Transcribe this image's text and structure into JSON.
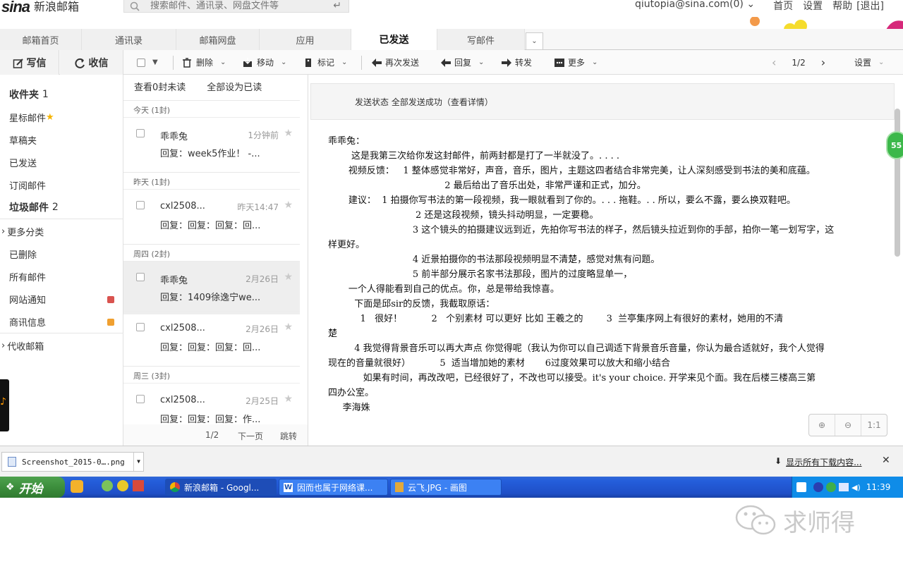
{
  "header": {
    "logo_mark": "sina",
    "logo_text": "新浪邮箱",
    "search_placeholder": "搜索邮件、通讯录、网盘文件等",
    "user": "qiutopia@sina.com(0)",
    "links": [
      "首页",
      "设置",
      "帮助",
      "[退出]"
    ]
  },
  "tabs": [
    "邮箱首页",
    "通讯录",
    "邮箱网盘",
    "应用",
    "已发送",
    "写邮件"
  ],
  "active_tab": "已发送",
  "toolbar": {
    "compose": "写信",
    "receive": "收信",
    "delete": "删除",
    "move": "移动",
    "mark": "标记",
    "resend": "再次发送",
    "reply": "回复",
    "forward": "转发",
    "more": "更多",
    "page": "1/2",
    "settings": "设置"
  },
  "sidebar": {
    "inbox": "收件夹",
    "inbox_count": "1",
    "starred": "星标邮件",
    "drafts": "草稿夹",
    "sent": "已发送",
    "subscriptions": "订阅邮件",
    "spam": "垃圾邮件",
    "spam_count": "2",
    "more_categories": "更多分类",
    "deleted": "已删除",
    "all_mail": "所有邮件",
    "site_notice": "网站通知",
    "commerce": "商讯信息",
    "collect": "代收邮箱",
    "site_notice_color": "#d9534f",
    "commerce_color": "#f0a030"
  },
  "list": {
    "view_unread": "查看0封未读",
    "mark_all_read": "全部设为已读",
    "groups": [
      "今天 (1封)",
      "昨天 (1封)",
      "周四 (2封)",
      "周三 (3封)"
    ],
    "messages": [
      {
        "from": "乖乖兔",
        "time": "1分钟前",
        "subject": "回复：week5作业！ -..."
      },
      {
        "from": "cxl2508...",
        "time": "昨天14:47",
        "subject": "回复：回复：回复：回..."
      },
      {
        "from": "乖乖兔",
        "time": "2月26日",
        "subject": "回复：1409徐逸宁we..."
      },
      {
        "from": "cxl2508...",
        "time": "2月26日",
        "subject": "回复：回复：回复：回..."
      },
      {
        "from": "cxl2508...",
        "time": "2月25日",
        "subject": "回复：回复：回复：作..."
      }
    ],
    "pager_page": "1/2",
    "pager_next": "下一页",
    "pager_jump": "跳转"
  },
  "reader": {
    "status": "发送状态 全部发送成功（查看详情）",
    "body_lines": [
      "乖乖兔：",
      "        这是我第三次给你发这封邮件，前两封都是打了一半就没了。. . . .",
      "       视频反馈：   1 整体感觉非常好，声音，音乐，图片，主题这四者结合非常完美，让人深刻感受到书法的美和底蕴。",
      "                                        2 最后给出了音乐出处，非常严谨和正式，加分。",
      "       建议：  1 拍摄你写书法的第一段视频，我一眼就看到了你的。. . . 拖鞋。. . 所以，要么不露，要么换双鞋吧。",
      "                              2 还是这段视频，镜头抖动明显，一定要稳。",
      "                             3 这个镜头的拍摄建议远到近，先拍你写书法的样子，然后镜头拉近到你的手部，拍你一笔一划写字，这",
      "样更好。",
      "                             4 近景拍摄你的书法那段视频明显不清楚，感觉对焦有问题。",
      "                             5 前半部分展示名家书法那段，图片的过度略显单一，",
      "       一个人得能看到自己的优点。你，总是带给我惊喜。",
      "         下面是邱sir的反馈，我截取原话：",
      "           1   很好！          2   个别素材 可以更好 比如 王羲之的        3  兰亭集序网上有很好的素材，她用的不清",
      "楚",
      "         4 我觉得背景音乐可以再大声点 你觉得呢（我认为你可以自己调适下背景音乐音量，你认为最合适就好，我个人觉得",
      "现在的音量就很好）          5  适当增加她的素材       6过度效果可以放大和缩小结合",
      "",
      "            如果有时间，再改改吧，已经很好了，不改也可以接受。it's your choice. 开学来见个面。我在后楼三楼高三第",
      "四办公室。",
      "",
      "     李海姝"
    ],
    "zoom_in": "⊕",
    "zoom_out": "⊖",
    "zoom_reset": "1:1",
    "badge": "55"
  },
  "download": {
    "file": "Screenshot_2015-0….png",
    "show_all": "显示所有下载内容..."
  },
  "taskbar": {
    "start": "开始",
    "tasks": [
      "新浪邮箱 - Googl...",
      "因而也属于网络课...",
      "云飞.JPG - 画图"
    ],
    "clock": "11:39"
  },
  "watermark": "求师得"
}
